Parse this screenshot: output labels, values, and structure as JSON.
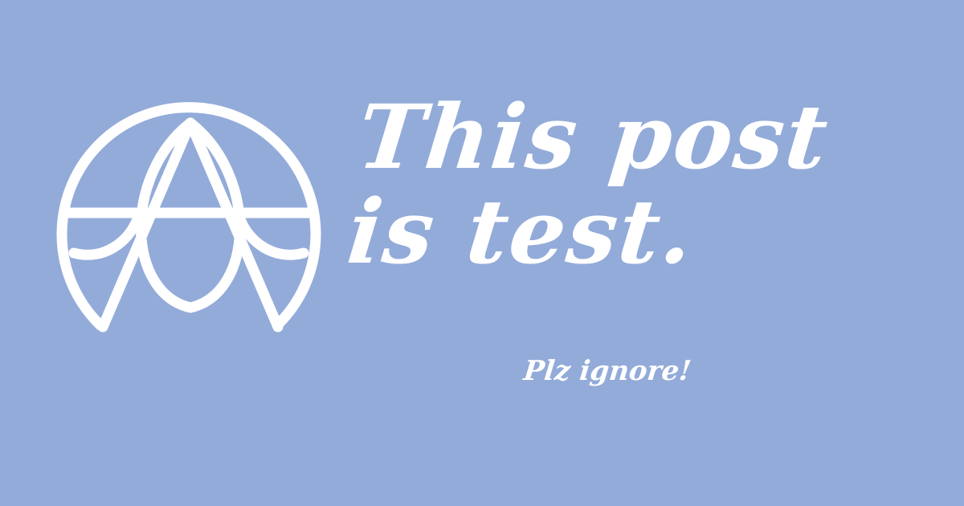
{
  "colors": {
    "background": "#93abd9",
    "foreground": "#ffffff"
  },
  "logo": {
    "icon": "globe-a-emblem-icon"
  },
  "headline": {
    "line1": "This post",
    "line2": "is test."
  },
  "tagline": "Plz ignore!"
}
